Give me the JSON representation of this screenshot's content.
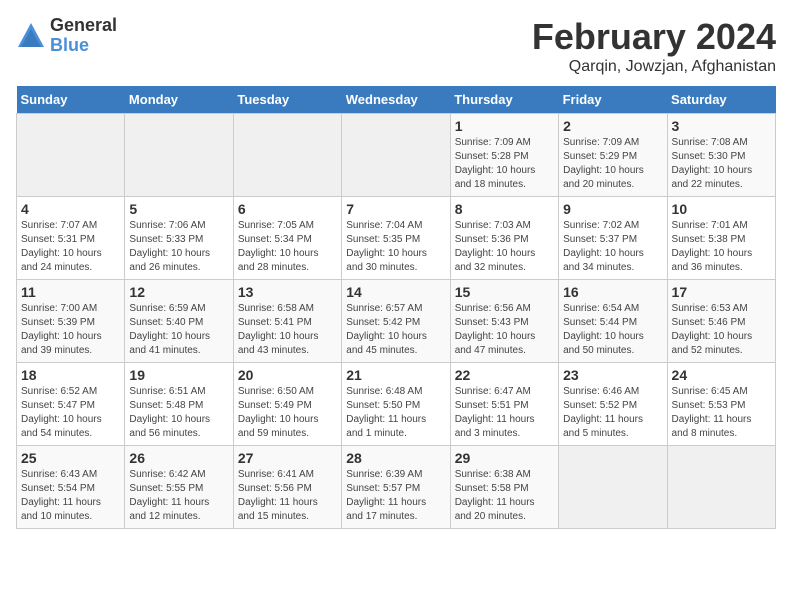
{
  "logo": {
    "general": "General",
    "blue": "Blue"
  },
  "title": "February 2024",
  "location": "Qarqin, Jowzjan, Afghanistan",
  "days_of_week": [
    "Sunday",
    "Monday",
    "Tuesday",
    "Wednesday",
    "Thursday",
    "Friday",
    "Saturday"
  ],
  "weeks": [
    [
      {
        "num": "",
        "info": ""
      },
      {
        "num": "",
        "info": ""
      },
      {
        "num": "",
        "info": ""
      },
      {
        "num": "",
        "info": ""
      },
      {
        "num": "1",
        "info": "Sunrise: 7:09 AM\nSunset: 5:28 PM\nDaylight: 10 hours\nand 18 minutes."
      },
      {
        "num": "2",
        "info": "Sunrise: 7:09 AM\nSunset: 5:29 PM\nDaylight: 10 hours\nand 20 minutes."
      },
      {
        "num": "3",
        "info": "Sunrise: 7:08 AM\nSunset: 5:30 PM\nDaylight: 10 hours\nand 22 minutes."
      }
    ],
    [
      {
        "num": "4",
        "info": "Sunrise: 7:07 AM\nSunset: 5:31 PM\nDaylight: 10 hours\nand 24 minutes."
      },
      {
        "num": "5",
        "info": "Sunrise: 7:06 AM\nSunset: 5:33 PM\nDaylight: 10 hours\nand 26 minutes."
      },
      {
        "num": "6",
        "info": "Sunrise: 7:05 AM\nSunset: 5:34 PM\nDaylight: 10 hours\nand 28 minutes."
      },
      {
        "num": "7",
        "info": "Sunrise: 7:04 AM\nSunset: 5:35 PM\nDaylight: 10 hours\nand 30 minutes."
      },
      {
        "num": "8",
        "info": "Sunrise: 7:03 AM\nSunset: 5:36 PM\nDaylight: 10 hours\nand 32 minutes."
      },
      {
        "num": "9",
        "info": "Sunrise: 7:02 AM\nSunset: 5:37 PM\nDaylight: 10 hours\nand 34 minutes."
      },
      {
        "num": "10",
        "info": "Sunrise: 7:01 AM\nSunset: 5:38 PM\nDaylight: 10 hours\nand 36 minutes."
      }
    ],
    [
      {
        "num": "11",
        "info": "Sunrise: 7:00 AM\nSunset: 5:39 PM\nDaylight: 10 hours\nand 39 minutes."
      },
      {
        "num": "12",
        "info": "Sunrise: 6:59 AM\nSunset: 5:40 PM\nDaylight: 10 hours\nand 41 minutes."
      },
      {
        "num": "13",
        "info": "Sunrise: 6:58 AM\nSunset: 5:41 PM\nDaylight: 10 hours\nand 43 minutes."
      },
      {
        "num": "14",
        "info": "Sunrise: 6:57 AM\nSunset: 5:42 PM\nDaylight: 10 hours\nand 45 minutes."
      },
      {
        "num": "15",
        "info": "Sunrise: 6:56 AM\nSunset: 5:43 PM\nDaylight: 10 hours\nand 47 minutes."
      },
      {
        "num": "16",
        "info": "Sunrise: 6:54 AM\nSunset: 5:44 PM\nDaylight: 10 hours\nand 50 minutes."
      },
      {
        "num": "17",
        "info": "Sunrise: 6:53 AM\nSunset: 5:46 PM\nDaylight: 10 hours\nand 52 minutes."
      }
    ],
    [
      {
        "num": "18",
        "info": "Sunrise: 6:52 AM\nSunset: 5:47 PM\nDaylight: 10 hours\nand 54 minutes."
      },
      {
        "num": "19",
        "info": "Sunrise: 6:51 AM\nSunset: 5:48 PM\nDaylight: 10 hours\nand 56 minutes."
      },
      {
        "num": "20",
        "info": "Sunrise: 6:50 AM\nSunset: 5:49 PM\nDaylight: 10 hours\nand 59 minutes."
      },
      {
        "num": "21",
        "info": "Sunrise: 6:48 AM\nSunset: 5:50 PM\nDaylight: 11 hours\nand 1 minute."
      },
      {
        "num": "22",
        "info": "Sunrise: 6:47 AM\nSunset: 5:51 PM\nDaylight: 11 hours\nand 3 minutes."
      },
      {
        "num": "23",
        "info": "Sunrise: 6:46 AM\nSunset: 5:52 PM\nDaylight: 11 hours\nand 5 minutes."
      },
      {
        "num": "24",
        "info": "Sunrise: 6:45 AM\nSunset: 5:53 PM\nDaylight: 11 hours\nand 8 minutes."
      }
    ],
    [
      {
        "num": "25",
        "info": "Sunrise: 6:43 AM\nSunset: 5:54 PM\nDaylight: 11 hours\nand 10 minutes."
      },
      {
        "num": "26",
        "info": "Sunrise: 6:42 AM\nSunset: 5:55 PM\nDaylight: 11 hours\nand 12 minutes."
      },
      {
        "num": "27",
        "info": "Sunrise: 6:41 AM\nSunset: 5:56 PM\nDaylight: 11 hours\nand 15 minutes."
      },
      {
        "num": "28",
        "info": "Sunrise: 6:39 AM\nSunset: 5:57 PM\nDaylight: 11 hours\nand 17 minutes."
      },
      {
        "num": "29",
        "info": "Sunrise: 6:38 AM\nSunset: 5:58 PM\nDaylight: 11 hours\nand 20 minutes."
      },
      {
        "num": "",
        "info": ""
      },
      {
        "num": "",
        "info": ""
      }
    ]
  ]
}
